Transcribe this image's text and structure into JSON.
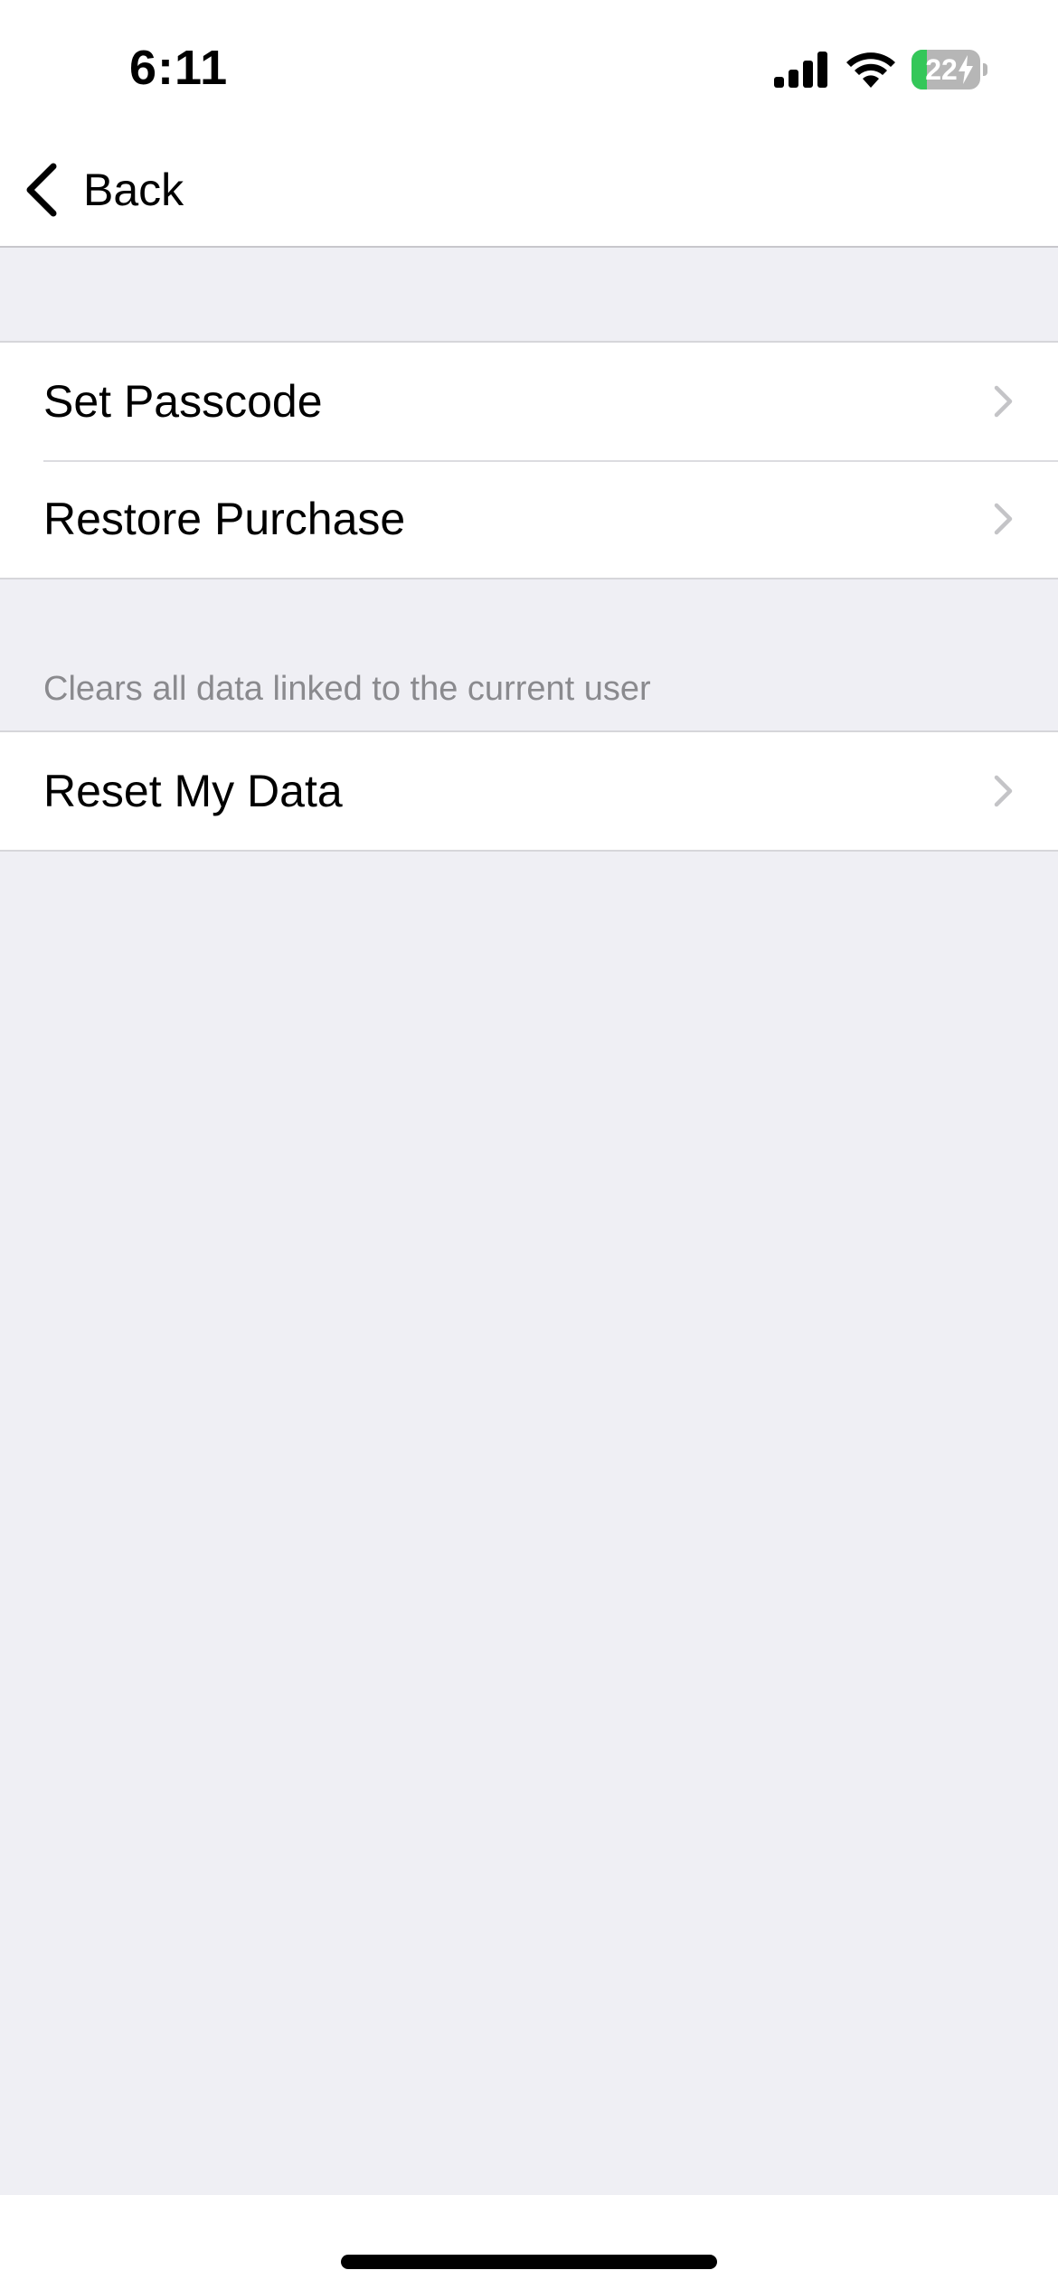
{
  "status_bar": {
    "time": "6:11",
    "battery_level": "22",
    "battery_percent": 22,
    "charging": true
  },
  "nav": {
    "back_label": "Back"
  },
  "groups": [
    {
      "items": [
        {
          "label": "Set Passcode"
        },
        {
          "label": "Restore Purchase"
        }
      ]
    },
    {
      "header": "Clears all data linked to the current user",
      "items": [
        {
          "label": "Reset My Data"
        }
      ]
    }
  ],
  "colors": {
    "background": "#efeff4",
    "battery_fill": "#34c759",
    "chevron": "#c4c4c7",
    "secondary_text": "#8a8a8e"
  },
  "icons": {
    "back": "chevron-left-icon",
    "row_disclosure": "chevron-right-icon",
    "signal": "cellular-signal-icon",
    "wifi": "wifi-icon",
    "battery": "battery-charging-icon"
  }
}
